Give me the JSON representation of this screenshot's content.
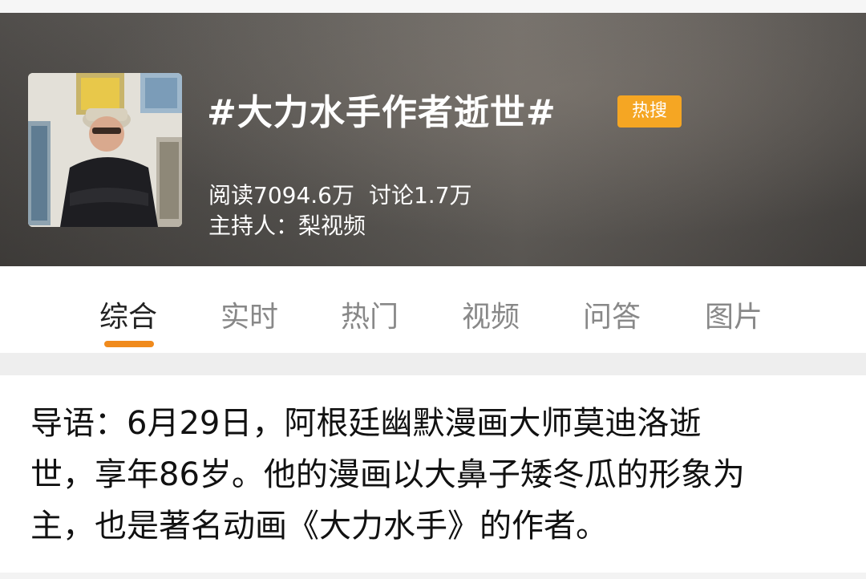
{
  "header": {
    "title": "#大力水手作者逝世#",
    "badge": "热搜",
    "reads": "阅读7094.6万",
    "discussions": "讨论1.7万",
    "host": "主持人：梨视频",
    "avatar_icon": "person-photo-icon"
  },
  "tabs": [
    {
      "label": "综合",
      "active": true
    },
    {
      "label": "实时",
      "active": false
    },
    {
      "label": "热门",
      "active": false
    },
    {
      "label": "视频",
      "active": false
    },
    {
      "label": "问答",
      "active": false
    },
    {
      "label": "图片",
      "active": false
    }
  ],
  "intro": {
    "lines": [
      "导语：6月29日，阿根廷幽默漫画大师莫迪洛逝",
      "世，享年86岁。他的漫画以大鼻子矮冬瓜的形象为",
      "主，也是著名动画《大力水手》的作者。"
    ]
  },
  "colors": {
    "badge": "#f5a623",
    "tab_indicator": "#f08a1c",
    "active_tab": "#222222",
    "inactive_tab": "#888888"
  }
}
